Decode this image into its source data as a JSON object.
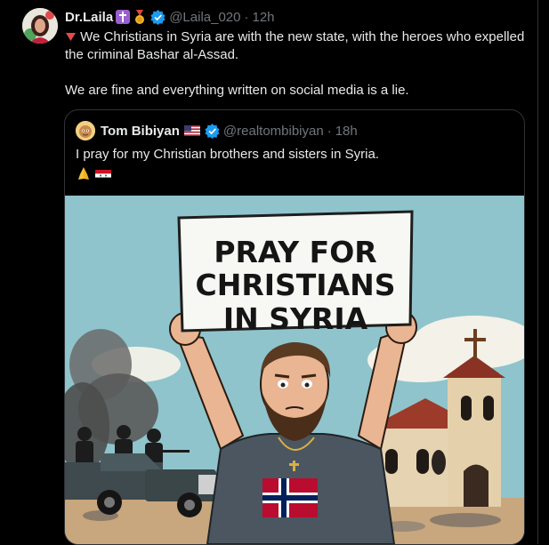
{
  "tweet": {
    "author_name": "Dr.Laila",
    "author_emoji": [
      "cross-emoji",
      "medal-emoji"
    ],
    "handle": "@Laila_020",
    "separator": "·",
    "time": "12h",
    "text_line1": "We Christians in Syria are with the new state, with the heroes who expelled the criminal Bashar al-Assad.",
    "text_line2": "We are fine and everything written on social media is a lie."
  },
  "quoted": {
    "author_name": "Tom Bibiyan",
    "handle": "@realtombibiyan",
    "separator": "·",
    "time": "18h",
    "text": "I pray for my Christian brothers and sisters in Syria.",
    "emoji": [
      "pray-emoji",
      "syria-flag-emoji"
    ],
    "image": {
      "sign_line1": "PRAY FOR",
      "sign_line2": "CHRISTIANS",
      "sign_line3": "IN SYRIA"
    }
  },
  "colors": {
    "verified": "#1d9bf0",
    "muted": "#71767b",
    "border": "#2f3336",
    "sky": "#8fc4cc"
  }
}
